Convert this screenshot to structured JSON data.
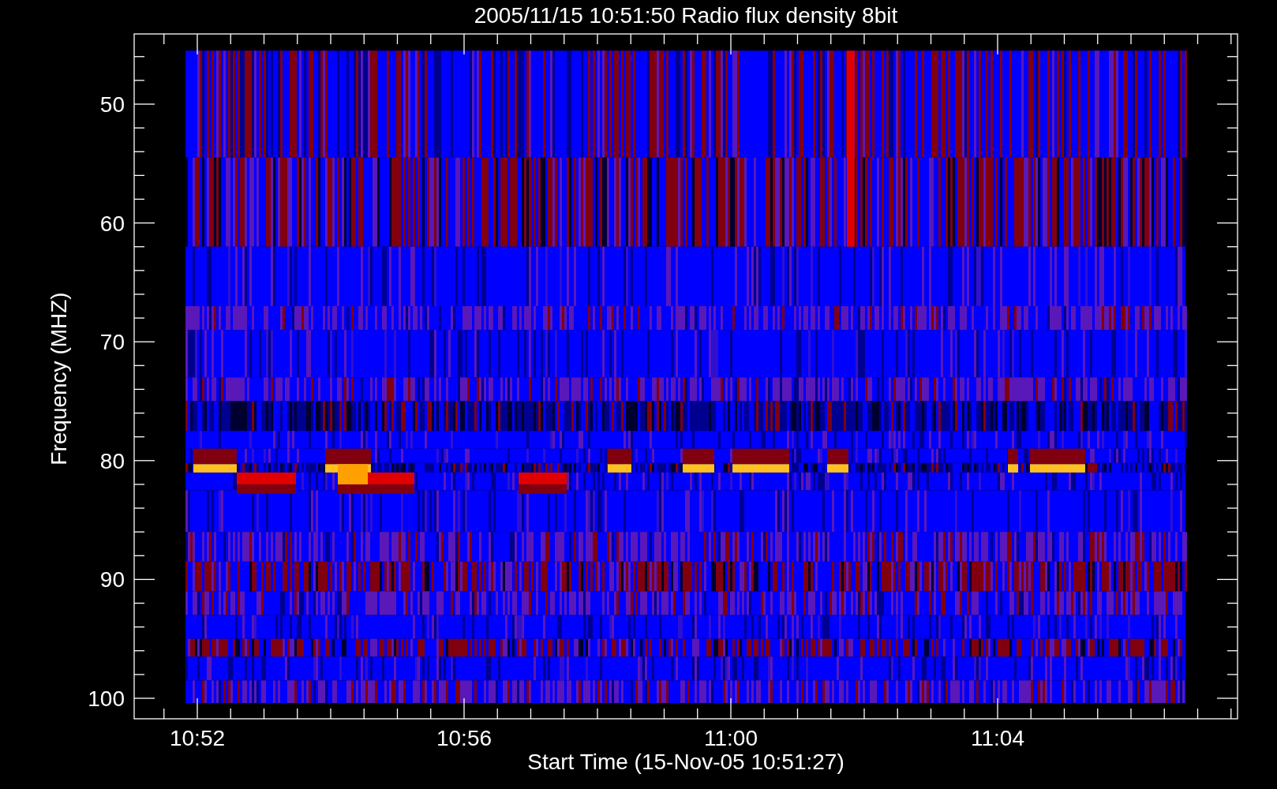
{
  "title": "2005/11/15 10:51:50 Radio flux density 8bit",
  "y_axis": {
    "label": "Frequency (MHZ)",
    "ticks": [
      "50",
      "60",
      "70",
      "80",
      "90",
      "100"
    ]
  },
  "x_axis": {
    "label": "Start Time (15-Nov-05 10:51:27)",
    "ticks": [
      "10:52",
      "10:56",
      "11:00",
      "11:04"
    ]
  }
}
